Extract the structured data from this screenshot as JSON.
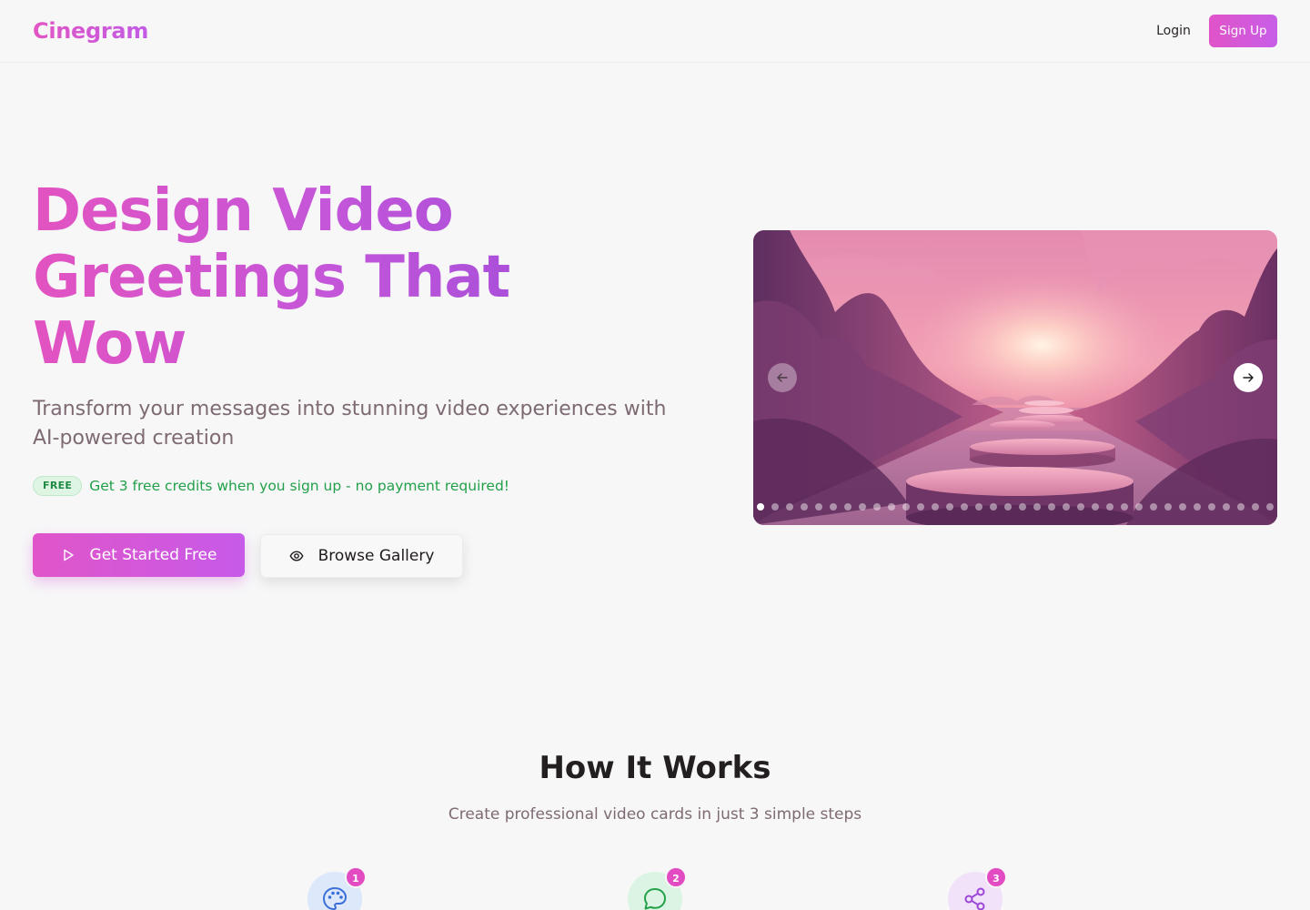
{
  "header": {
    "brand": "Cinegram",
    "login_label": "Login",
    "signup_label": "Sign Up"
  },
  "hero": {
    "title_lines": [
      "Design Video",
      "Greetings That",
      "Wow"
    ],
    "subtitle": "Transform your messages into stunning video experiences with AI-powered creation",
    "badge": "FREE",
    "promo": "Get 3 free credits when you sign up - no payment required!",
    "primary_cta": "Get Started Free",
    "primary_cta_icon": "play-icon",
    "secondary_cta": "Browse Gallery",
    "secondary_cta_icon": "eye-icon"
  },
  "carousel": {
    "prev_icon": "arrow-left-icon",
    "next_icon": "arrow-right-icon",
    "slide_count": 36,
    "active_index": 0
  },
  "how_it_works": {
    "title": "How It Works",
    "subtitle": "Create professional video cards in just 3 simple steps",
    "steps": [
      {
        "number": "1",
        "icon": "palette-icon"
      },
      {
        "number": "2",
        "icon": "chat-bubble-icon"
      },
      {
        "number": "3",
        "icon": "share-icon"
      }
    ]
  },
  "colors": {
    "brand_gradient_start": "#e255c3",
    "brand_gradient_end": "#c25be6",
    "promo_green": "#22a049",
    "step_badge": "#e24bc2"
  }
}
